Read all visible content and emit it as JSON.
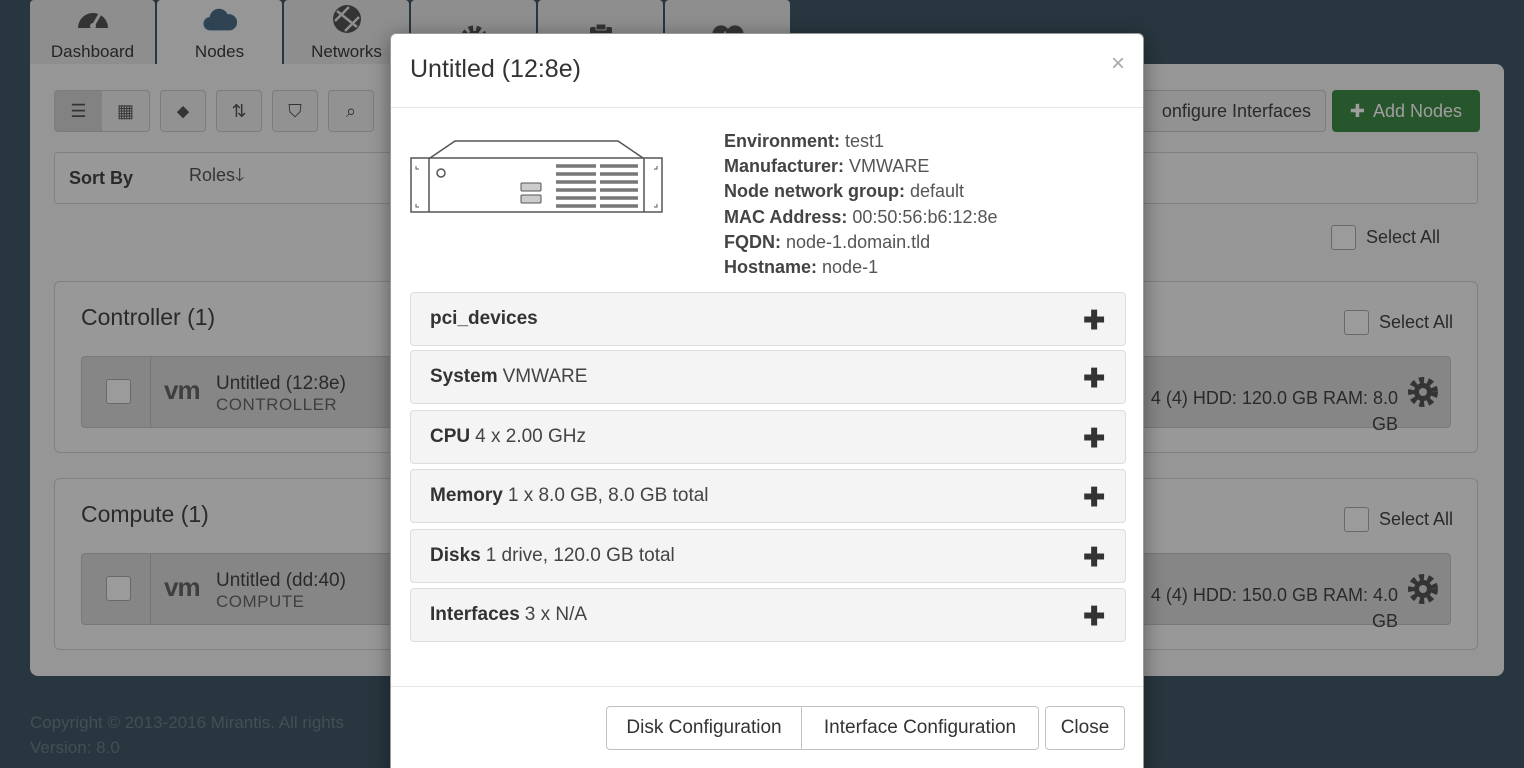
{
  "tabs": [
    {
      "label": "Dashboard",
      "icon": "dashboard-icon"
    },
    {
      "label": "Nodes",
      "icon": "cloud-icon"
    },
    {
      "label": "Networks",
      "icon": "network-icon"
    },
    {
      "label": "",
      "icon": "settings-icon"
    },
    {
      "label": "",
      "icon": "clipboard-icon"
    },
    {
      "label": "",
      "icon": "health-icon"
    }
  ],
  "toolbar": {
    "configure_interfaces": "onfigure Interfaces",
    "add_nodes": "Add Nodes"
  },
  "sort": {
    "label": "Sort By",
    "value": "Roles"
  },
  "select_all": "Select All",
  "groups": [
    {
      "title": "Controller (1)",
      "node": {
        "vm": "vm",
        "name": "Untitled (12:8e)",
        "role": "CONTROLLER",
        "spec": "4 (4) HDD: 120.0 GB RAM: 8.0 GB"
      }
    },
    {
      "title": "Compute (1)",
      "node": {
        "vm": "vm",
        "name": "Untitled (dd:40)",
        "role": "COMPUTE",
        "spec": "4 (4) HDD: 150.0 GB RAM: 4.0 GB"
      }
    }
  ],
  "footer": {
    "copyright": "Copyright © 2013-2016 Mirantis. All rights",
    "version": "Version: 8.0"
  },
  "modal": {
    "title": "Untitled (12:8e)",
    "close_symbol": "×",
    "properties": [
      {
        "key": "Environment:",
        "value": "test1"
      },
      {
        "key": "Manufacturer:",
        "value": "VMWARE"
      },
      {
        "key": "Node network group:",
        "value": "default"
      },
      {
        "key": "MAC Address:",
        "value": "00:50:56:b6:12:8e"
      },
      {
        "key": "FQDN:",
        "value": "node-1.domain.tld"
      },
      {
        "key": "Hostname:",
        "value": "node-1"
      }
    ],
    "sections": [
      {
        "title": "pci_devices",
        "summary": ""
      },
      {
        "title": "System",
        "summary": "VMWARE"
      },
      {
        "title": "CPU",
        "summary": "4 x 2.00 GHz"
      },
      {
        "title": "Memory",
        "summary": "1 x 8.0 GB, 8.0 GB total"
      },
      {
        "title": "Disks",
        "summary": "1 drive, 120.0 GB total"
      },
      {
        "title": "Interfaces",
        "summary": "3 x N/A"
      }
    ],
    "buttons": {
      "disk": "Disk Configuration",
      "interface": "Interface Configuration",
      "close": "Close"
    }
  }
}
